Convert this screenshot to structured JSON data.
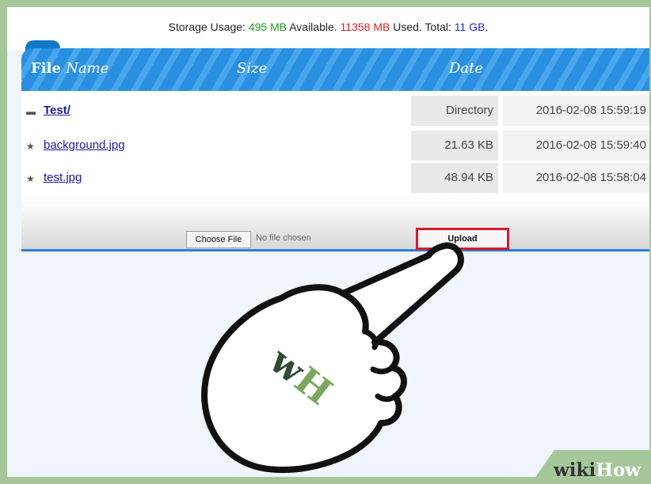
{
  "storage": {
    "prefix": "Storage Usage: ",
    "available_value": "495 MB",
    "available_label": " Available. ",
    "used_value": "11358 MB",
    "used_label": " Used. Total: ",
    "total_value": "11 GB",
    "suffix": "."
  },
  "table": {
    "header": {
      "file_bold": "File",
      "file_italic": "Name",
      "size": "Size",
      "date": "Date"
    },
    "rows": [
      {
        "name": "Test/",
        "size": "Directory",
        "date": "2016-02-08 15:59:19",
        "icon": "folder-icon"
      },
      {
        "name": "background.jpg",
        "size": "21.63 KB",
        "date": "2016-02-08 15:59:40",
        "icon": "file-star-icon"
      },
      {
        "name": "test.jpg",
        "size": "48.94 KB",
        "date": "2016-02-08 15:58:04",
        "icon": "file-star-icon"
      }
    ]
  },
  "upload": {
    "choose_label": "Choose File",
    "no_file": "No file chosen",
    "upload_label": "Upload"
  },
  "overlay": {
    "hand_logo": "wH",
    "brand_wiki": "wiki",
    "brand_how": "How"
  },
  "colors": {
    "accent_green": "#1e9a1e",
    "accent_red": "#e02222",
    "accent_blue": "#2222dd",
    "header_blue": "#2a8fe0",
    "highlight_red": "#d7192b"
  }
}
